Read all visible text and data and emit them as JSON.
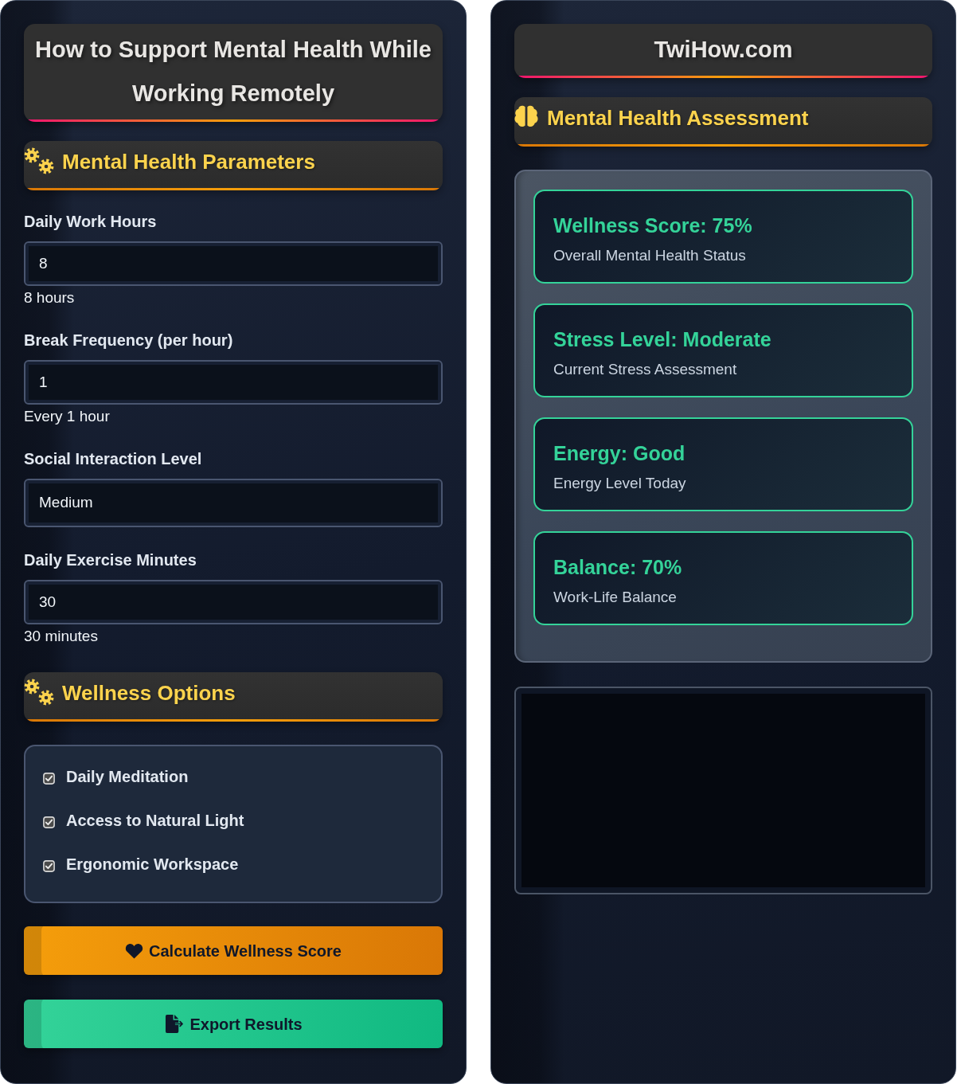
{
  "left_panel": {
    "title": "How to Support Mental Health While Working Remotely",
    "parameters": {
      "heading": "Mental Health Parameters",
      "fields": [
        {
          "kind": "input",
          "label": "Daily Work Hours",
          "value": "8",
          "note": "8 hours"
        },
        {
          "kind": "input",
          "label": "Break Frequency (per hour)",
          "value": "1",
          "note": "Every 1 hour"
        },
        {
          "kind": "select",
          "label": "Social Interaction Level",
          "value": "Medium"
        },
        {
          "kind": "input",
          "label": "Daily Exercise Minutes",
          "value": "30",
          "note": "30 minutes"
        }
      ]
    },
    "wellness_options": {
      "heading": "Wellness Options",
      "options": [
        {
          "label": "Daily Meditation",
          "checked": true
        },
        {
          "label": "Access to Natural Light",
          "checked": true
        },
        {
          "label": "Ergonomic Workspace",
          "checked": true
        }
      ]
    },
    "buttons": [
      {
        "kind": "calculate",
        "label": "Calculate Wellness Score"
      },
      {
        "kind": "export",
        "label": "Export Results"
      }
    ]
  },
  "right_panel": {
    "site_name": "TwiHow.com",
    "heading": "Mental Health Assessment",
    "results": [
      {
        "title": "Wellness Score: 75%",
        "subtitle": "Overall Mental Health Status"
      },
      {
        "title": "Stress Level: Moderate",
        "subtitle": "Current Stress Assessment"
      },
      {
        "title": "Energy: Good",
        "subtitle": "Energy Level Today"
      },
      {
        "title": "Balance: 70%",
        "subtitle": "Work-Life Balance"
      }
    ]
  }
}
